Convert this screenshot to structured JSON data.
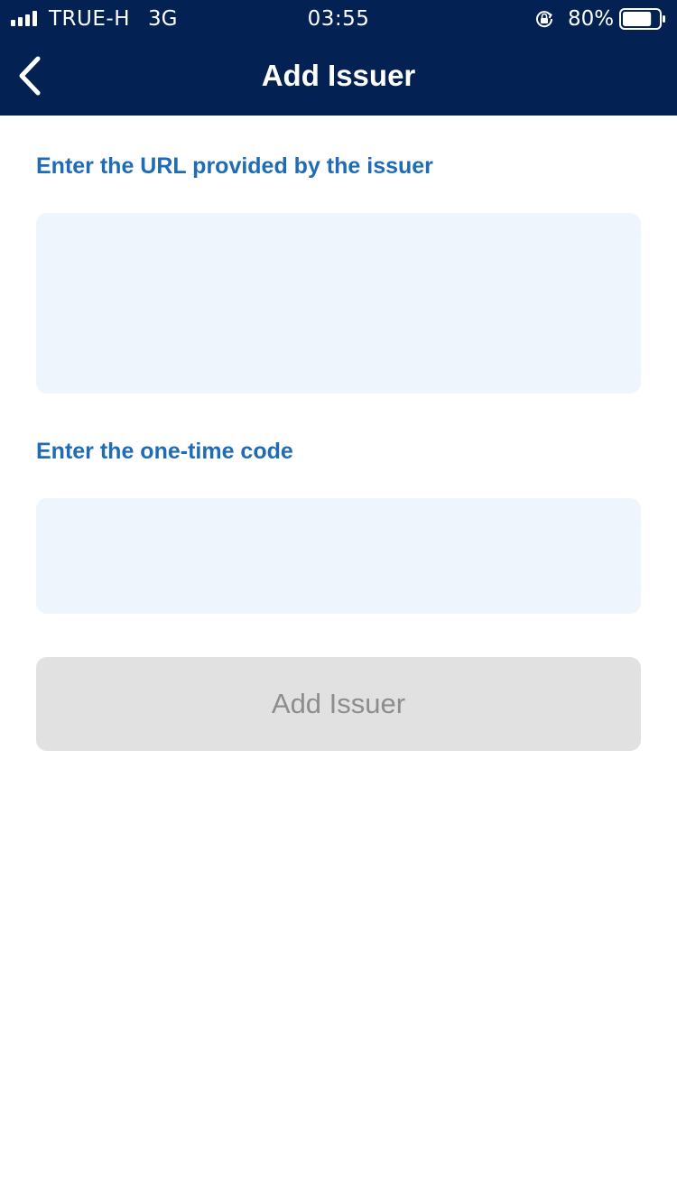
{
  "status_bar": {
    "carrier": "TRUE-H",
    "network": "3G",
    "time": "03:55",
    "battery_percent": "80%",
    "signal_icon": "signal-bars-icon",
    "lock_icon": "orientation-lock-icon",
    "battery_icon": "battery-icon",
    "battery_level": 0.8
  },
  "header": {
    "title": "Add Issuer",
    "back_icon": "chevron-left-icon"
  },
  "form": {
    "url_label": "Enter the URL provided by the issuer",
    "url_value": "",
    "code_label": "Enter the one-time code",
    "code_value": "",
    "submit_label": "Add Issuer",
    "submit_enabled": false
  },
  "colors": {
    "header_bg": "#042153",
    "label": "#1e6cb8",
    "input_bg": "#eef5fd",
    "button_disabled_bg": "#e1e1e1",
    "button_disabled_text": "#8d8d8d"
  }
}
